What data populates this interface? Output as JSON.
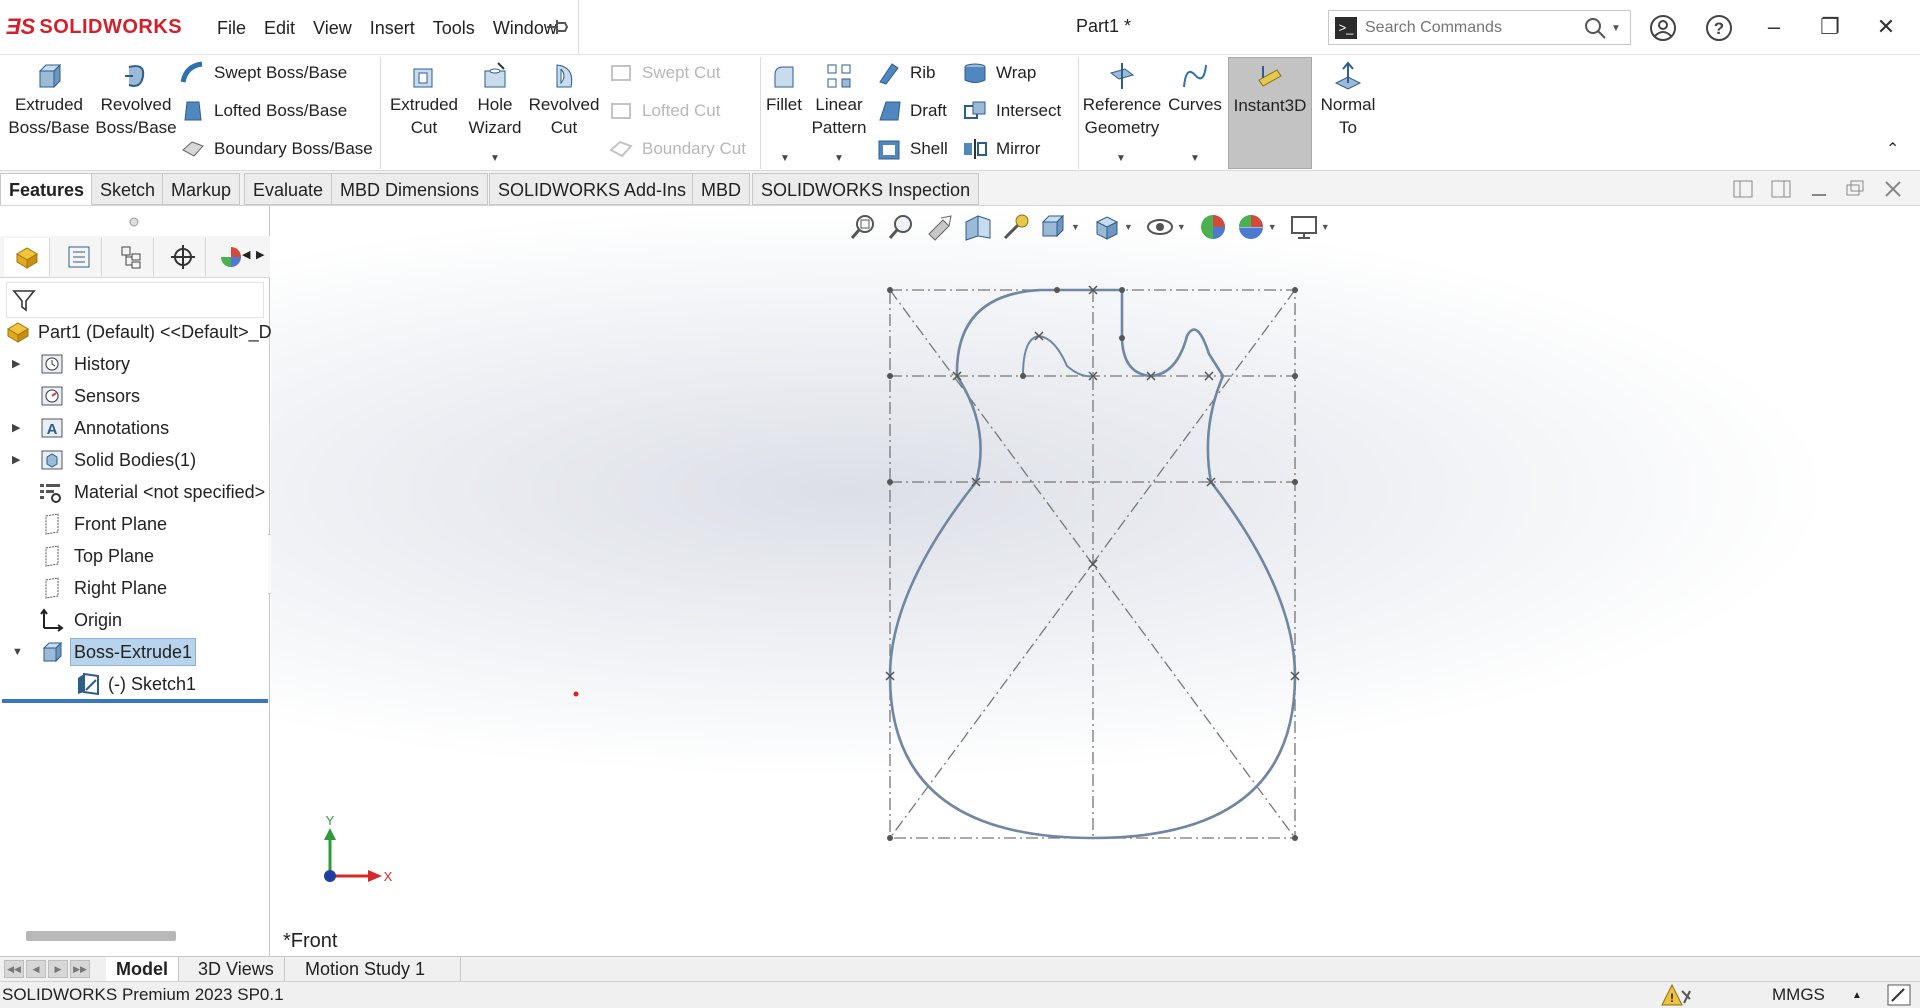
{
  "app": {
    "brand": "SOLIDWORKS",
    "document_title": "Part1 *",
    "menus": [
      "File",
      "Edit",
      "View",
      "Insert",
      "Tools",
      "Window"
    ]
  },
  "search": {
    "placeholder": "Search Commands"
  },
  "ribbon": {
    "extruded_boss": [
      "Extruded",
      "Boss/Base"
    ],
    "revolved_boss": [
      "Revolved",
      "Boss/Base"
    ],
    "swept_boss": "Swept Boss/Base",
    "lofted_boss": "Lofted Boss/Base",
    "boundary_boss": "Boundary Boss/Base",
    "extruded_cut": [
      "Extruded",
      "Cut"
    ],
    "hole_wizard": [
      "Hole",
      "Wizard"
    ],
    "revolved_cut": [
      "Revolved",
      "Cut"
    ],
    "swept_cut": "Swept Cut",
    "lofted_cut": "Lofted Cut",
    "boundary_cut": "Boundary Cut",
    "fillet": "Fillet",
    "linear_pattern": [
      "Linear",
      "Pattern"
    ],
    "rib": "Rib",
    "draft": "Draft",
    "shell": "Shell",
    "wrap": "Wrap",
    "intersect": "Intersect",
    "mirror": "Mirror",
    "reference_geometry": [
      "Reference",
      "Geometry"
    ],
    "curves": "Curves",
    "instant3d": "Instant3D",
    "normal_to": [
      "Normal",
      "To"
    ]
  },
  "tabs": [
    "Features",
    "Sketch",
    "Markup",
    "Evaluate",
    "MBD Dimensions",
    "SOLIDWORKS Add-Ins",
    "MBD",
    "SOLIDWORKS Inspection"
  ],
  "feature_tree": {
    "root": "Part1 (Default) <<Default>_D",
    "items": [
      {
        "label": "History",
        "icon": "history-icon"
      },
      {
        "label": "Sensors",
        "icon": "sensors-icon"
      },
      {
        "label": "Annotations",
        "icon": "annotations-icon"
      },
      {
        "label": "Solid Bodies(1)",
        "icon": "solid-bodies-icon"
      },
      {
        "label": "Material <not specified>",
        "icon": "material-icon"
      },
      {
        "label": "Front Plane",
        "icon": "plane-icon"
      },
      {
        "label": "Top Plane",
        "icon": "plane-icon"
      },
      {
        "label": "Right Plane",
        "icon": "plane-icon"
      },
      {
        "label": "Origin",
        "icon": "origin-icon"
      },
      {
        "label": "Boss-Extrude1",
        "icon": "boss-extrude-icon"
      },
      {
        "label": "(-) Sketch1",
        "icon": "sketch-icon"
      }
    ]
  },
  "viewport": {
    "view_name": "*Front",
    "triad_x": "X",
    "triad_y": "Y"
  },
  "bottom_tabs": [
    "Model",
    "3D Views",
    "Motion Study 1"
  ],
  "status": {
    "version": "SOLIDWORKS Premium 2023 SP0.1",
    "units": "MMGS"
  },
  "colors": {
    "brand_red": "#d4202b",
    "sketch_line": "#6a88a8",
    "selection": "#b8d4ec"
  }
}
